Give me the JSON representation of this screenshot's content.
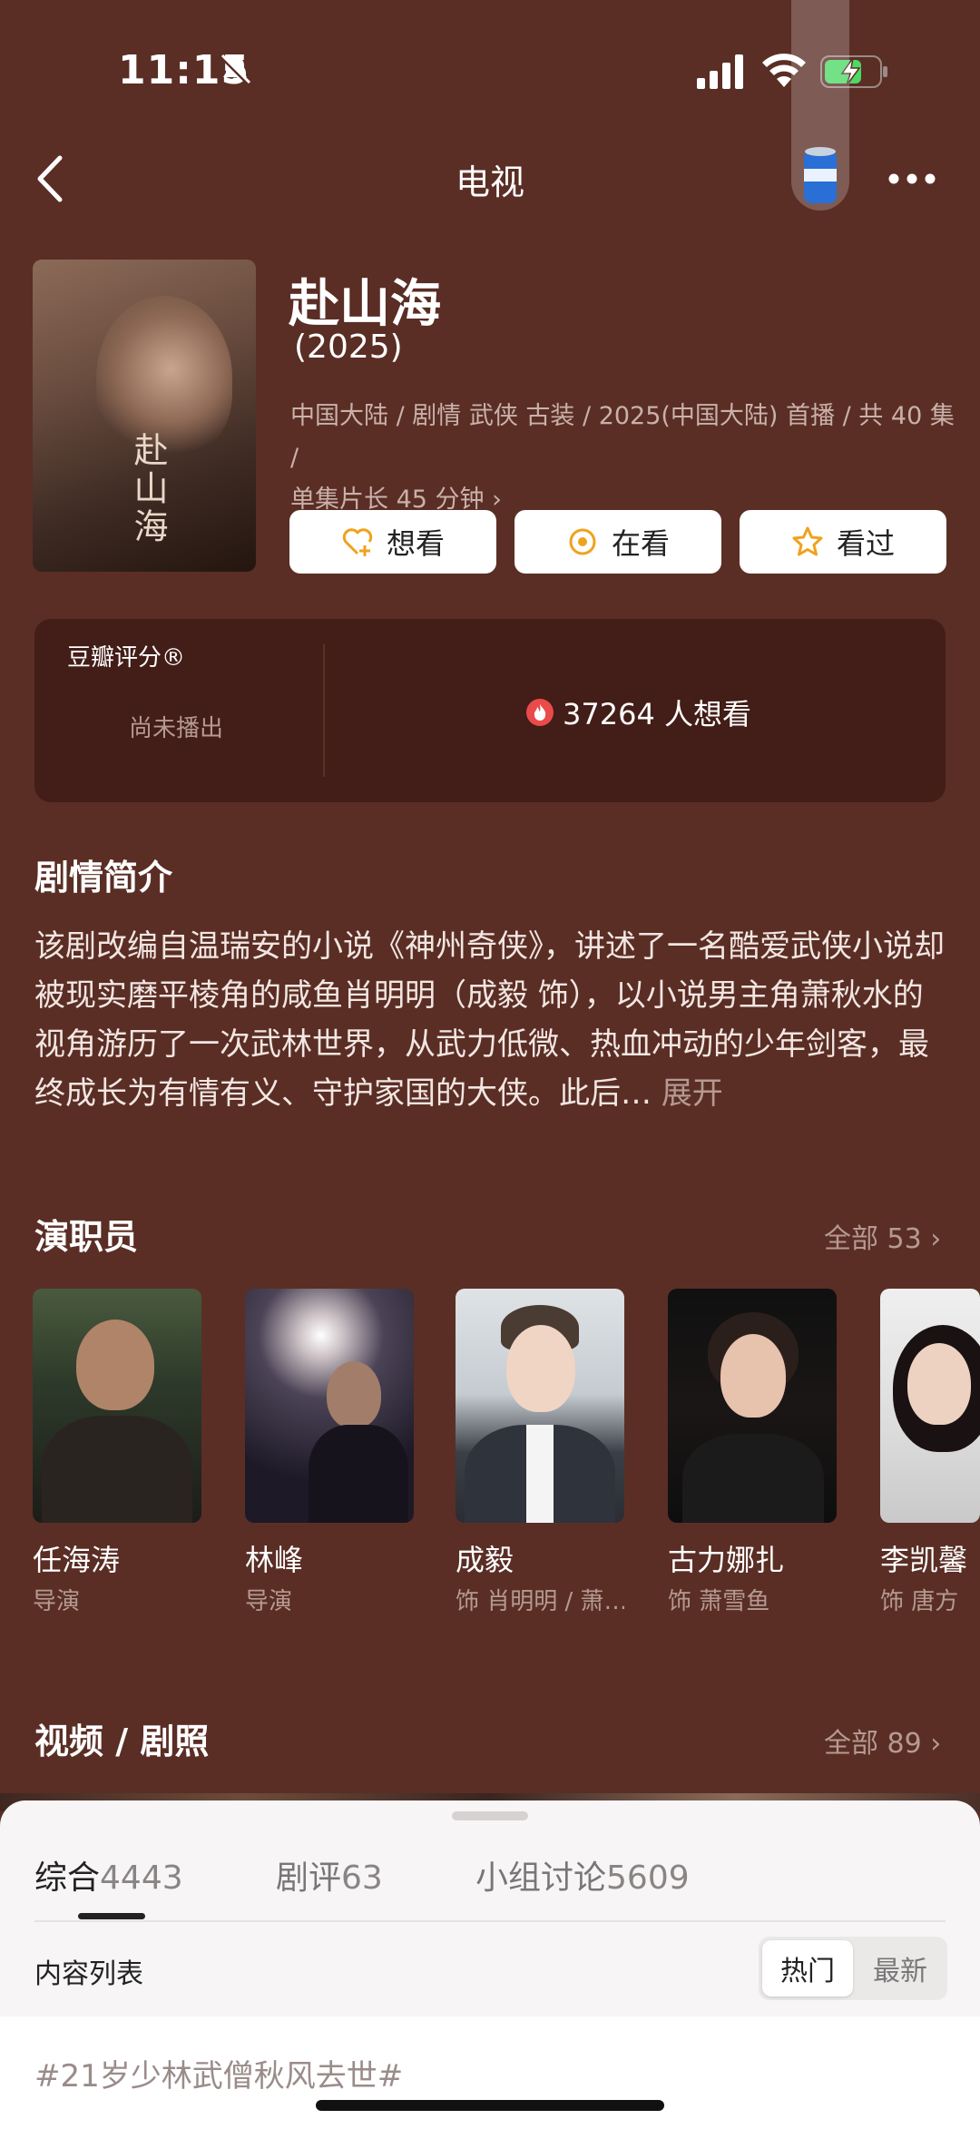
{
  "status_bar": {
    "time": "11:15"
  },
  "nav": {
    "title": "电视"
  },
  "show": {
    "title": "赴山海",
    "year": "(2025)",
    "meta_line1": "中国大陆 / 剧情 武侠 古装 / 2025(中国大陆) 首播 / 共 40 集 /",
    "meta_line2": "单集片长 45 分钟",
    "poster_text": "赴山海"
  },
  "actions": [
    {
      "label": "想看",
      "icon": "heart-plus-icon"
    },
    {
      "label": "在看",
      "icon": "target-icon"
    },
    {
      "label": "看过",
      "icon": "star-icon"
    }
  ],
  "rating": {
    "label": "豆瓣评分®",
    "status": "尚未播出",
    "want_count": "37264 人想看"
  },
  "synopsis": {
    "title": "剧情简介",
    "text": "该剧改编自温瑞安的小说《神州奇侠》，讲述了一名酷爱武侠小说却被现实磨平棱角的咸鱼肖明明（成毅 饰），以小说男主角萧秋水的视角游历了一次武林世界，从武力低微、热血冲动的少年剑客，最终成长为有情有义、守护家国的大侠。此后…",
    "expand": "展开"
  },
  "cast": {
    "title": "演职员",
    "all_label": "全部 53",
    "members": [
      {
        "name": "任海涛",
        "role": "导演"
      },
      {
        "name": "林峰",
        "role": "导演"
      },
      {
        "name": "成毅",
        "role": "饰 肖明明 / 萧…"
      },
      {
        "name": "古力娜扎",
        "role": "饰 萧雪鱼"
      },
      {
        "name": "李凯馨",
        "role": "饰 唐方"
      }
    ]
  },
  "videos": {
    "title": "视频 / 剧照",
    "all_label": "全部 89"
  },
  "sheet": {
    "tabs": [
      {
        "label": "综合",
        "count": "4443"
      },
      {
        "label": "剧评",
        "count": "63"
      },
      {
        "label": "小组讨论",
        "count": "5609"
      }
    ],
    "list_label": "内容列表",
    "toggle_hot": "热门",
    "toggle_new": "最新",
    "topic": "#21岁少林武僧秋风去世#"
  },
  "colors": {
    "background": "#5a2e25",
    "card": "#431d17",
    "sheet": "#f7f5f5",
    "accent_orange": "#f0a21e",
    "fire_red": "#e94b4b"
  }
}
